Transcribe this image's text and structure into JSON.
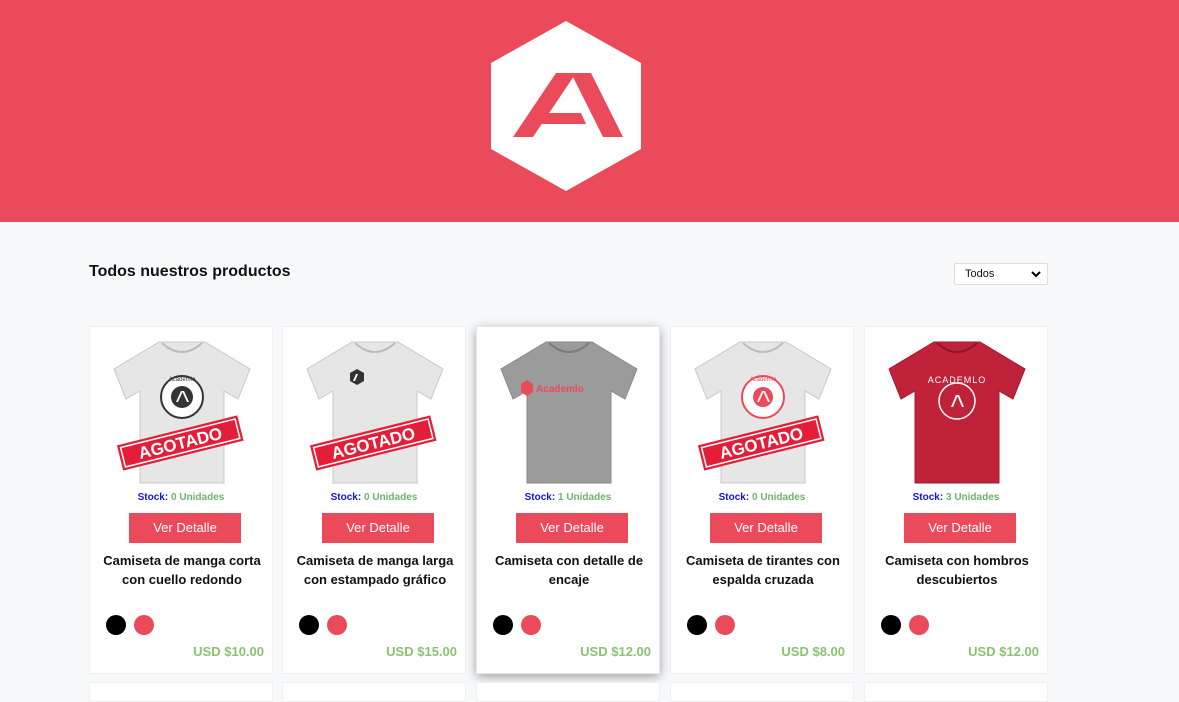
{
  "colors": {
    "brand": "#ea4a5a",
    "stock_label": "#1515d4",
    "stock_value": "#6cb56c",
    "price": "#8bc26f"
  },
  "header": {
    "logo_icon": "academlo-logo-icon"
  },
  "main": {
    "title": "Todos nuestros productos",
    "filter": {
      "selected": "Todos"
    },
    "products": [
      {
        "name": "Camiseta de manga corta con cuello redondo",
        "stock_label": "Stock:",
        "stock_value": "0 Unidades",
        "button": "Ver Detalle",
        "price": "USD $10.00",
        "badge": "AGOTADO",
        "shirt_color": "#e6e6e6",
        "print_text": "Academlo",
        "colors": [
          "black",
          "red"
        ]
      },
      {
        "name": "Camiseta de manga larga con estampado gráfico",
        "stock_label": "Stock:",
        "stock_value": "0 Unidades",
        "button": "Ver Detalle",
        "price": "USD $15.00",
        "badge": "AGOTADO",
        "shirt_color": "#e6e6e6",
        "print_text": "",
        "colors": [
          "black",
          "red"
        ]
      },
      {
        "name": "Camiseta con detalle de encaje",
        "stock_label": "Stock:",
        "stock_value": "1 Unidades",
        "button": "Ver Detalle",
        "price": "USD $12.00",
        "badge": "",
        "shirt_color": "#9b9b9b",
        "print_text": "Academlo",
        "colors": [
          "black",
          "red"
        ]
      },
      {
        "name": "Camiseta de tirantes con espalda cruzada",
        "stock_label": "Stock:",
        "stock_value": "0 Unidades",
        "button": "Ver Detalle",
        "price": "USD $8.00",
        "badge": "AGOTADO",
        "shirt_color": "#e6e6e6",
        "print_text": "Academlo",
        "colors": [
          "black",
          "red"
        ]
      },
      {
        "name": "Camiseta con hombros descubiertos",
        "stock_label": "Stock:",
        "stock_value": "3 Unidades",
        "button": "Ver Detalle",
        "price": "USD $12.00",
        "badge": "",
        "shirt_color": "#c0223a",
        "print_text": "ACADEMLO",
        "colors": [
          "black",
          "red"
        ]
      }
    ]
  }
}
